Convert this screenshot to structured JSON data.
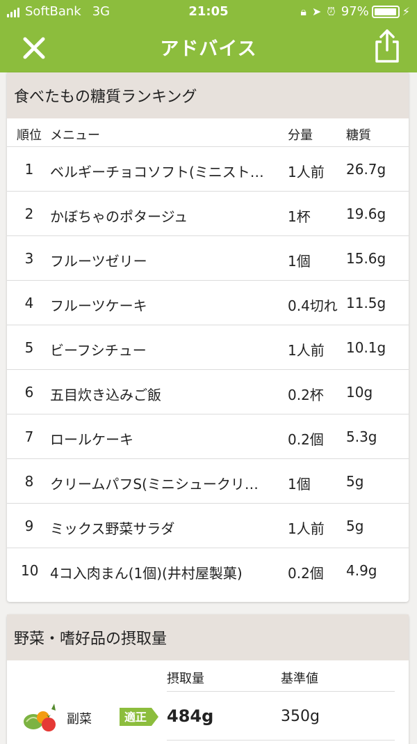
{
  "status_bar": {
    "carrier": "SoftBank",
    "network": "3G",
    "time": "21:05",
    "battery": "97%",
    "battery_level": 0.97
  },
  "nav": {
    "title": "アドバイス",
    "close_icon": "close-icon",
    "share_icon": "share-icon"
  },
  "ranking": {
    "title": "食べたもの糖質ランキング",
    "headers": {
      "rank": "順位",
      "menu": "メニュー",
      "amount": "分量",
      "carb": "糖質"
    },
    "rows": [
      {
        "rank": "1",
        "menu": "ベルギーチョコソフト(ミニスト…",
        "amount": "1人前",
        "carb": "26.7g"
      },
      {
        "rank": "2",
        "menu": "かぼちゃのポタージュ",
        "amount": "1杯",
        "carb": "19.6g"
      },
      {
        "rank": "3",
        "menu": "フルーツゼリー",
        "amount": "1個",
        "carb": "15.6g"
      },
      {
        "rank": "4",
        "menu": "フルーツケーキ",
        "amount": "0.4切れ",
        "carb": "11.5g"
      },
      {
        "rank": "5",
        "menu": "ビーフシチュー",
        "amount": "1人前",
        "carb": "10.1g"
      },
      {
        "rank": "6",
        "menu": "五目炊き込みご飯",
        "amount": "0.2杯",
        "carb": "10g"
      },
      {
        "rank": "7",
        "menu": "ロールケーキ",
        "amount": "0.2個",
        "carb": "5.3g"
      },
      {
        "rank": "8",
        "menu": "クリームパフS(ミニシュークリ…",
        "amount": "1個",
        "carb": "5g"
      },
      {
        "rank": "9",
        "menu": "ミックス野菜サラダ",
        "amount": "1人前",
        "carb": "5g"
      },
      {
        "rank": "10",
        "menu": "4コ入肉まん(1個)(井村屋製菓)",
        "amount": "0.2個",
        "carb": "4.9g"
      }
    ]
  },
  "intake": {
    "title": "野菜・嗜好品の摂取量",
    "headers": {
      "intake": "摂取量",
      "standard": "基準値"
    },
    "rows": [
      {
        "icon": "vegetable-icon",
        "category": "副菜",
        "status": "適正",
        "intake": "484g",
        "standard": "350g"
      }
    ]
  },
  "colors": {
    "header_green": "#8cbd3d",
    "card_header": "#e7e1dc",
    "badge_green": "#8cbd3d"
  }
}
